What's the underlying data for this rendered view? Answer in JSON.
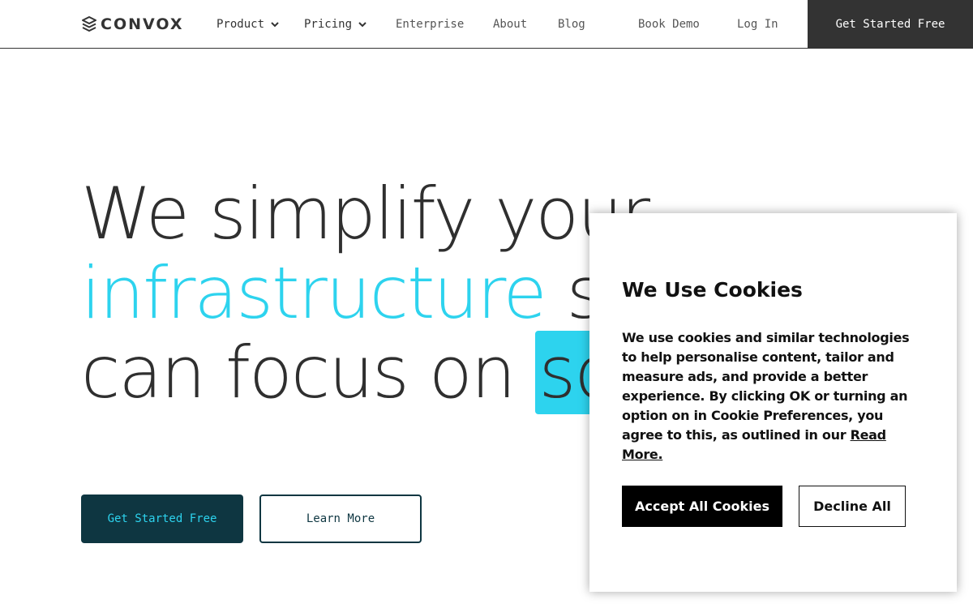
{
  "header": {
    "logo_text": "CONVOX",
    "nav": {
      "product": "Product",
      "pricing": "Pricing",
      "enterprise": "Enterprise",
      "about": "About",
      "blog": "Blog",
      "book_demo": "Book Demo",
      "log_in": "Log In"
    },
    "cta": "Get Started Free"
  },
  "hero": {
    "line1": "We simplify your",
    "line2_accent": "infrastructure",
    "line2_rest": " so",
    "line3_text": "can focus on ",
    "line3_highlight": "so",
    "primary_button": "Get Started Free",
    "secondary_button": "Learn More"
  },
  "cookie_banner": {
    "title": "We Use Cookies",
    "body": "We use cookies and similar technologies to help personalise content, tailor and measure ads, and provide a better experience. By clicking OK or turning an option on in Cookie Preferences, you agree to this, as outlined in our ",
    "link": "Read More.",
    "accept": "Accept All Cookies",
    "decline": "Decline All"
  },
  "colors": {
    "accent": "#2dd3ee",
    "dark_teal": "#0e3641",
    "header_cta_bg": "#333333"
  },
  "icons": [
    "convox-logo-icon",
    "chevron-down-icon"
  ]
}
